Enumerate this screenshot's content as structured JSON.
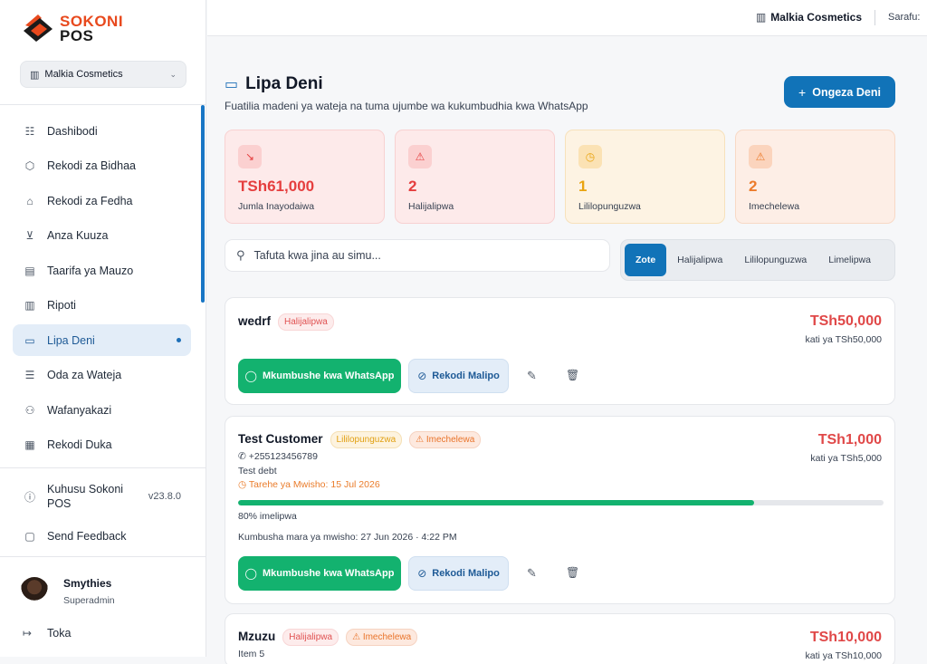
{
  "brand": {
    "line1": "SOKONI",
    "line2": "POS"
  },
  "store_selector": {
    "value": "Malkia Cosmetics"
  },
  "nav": [
    {
      "label": "Dashibodi",
      "icon": "grid-icon",
      "glyph": "☷"
    },
    {
      "label": "Rekodi za Bidhaa",
      "icon": "box-icon",
      "glyph": "⬡"
    },
    {
      "label": "Rekodi za Fedha",
      "icon": "bank-icon",
      "glyph": "⌂"
    },
    {
      "label": "Anza Kuuza",
      "icon": "cart-icon",
      "glyph": "⊻"
    },
    {
      "label": "Taarifa ya Mauzo",
      "icon": "clipboard-icon",
      "glyph": "▤"
    },
    {
      "label": "Ripoti",
      "icon": "bar-chart-icon",
      "glyph": "▥"
    },
    {
      "label": "Lipa Deni",
      "icon": "wallet-icon",
      "glyph": "▭",
      "active": true
    },
    {
      "label": "Oda za Wateja",
      "icon": "list-icon",
      "glyph": "☰"
    },
    {
      "label": "Wafanyakazi",
      "icon": "users-icon",
      "glyph": "⚇"
    },
    {
      "label": "Rekodi Duka",
      "icon": "store-icon",
      "glyph": "▦"
    }
  ],
  "about": {
    "label": "Kuhusu Sokoni POS",
    "version": "v23.8.0"
  },
  "feedback": {
    "label": "Send Feedback"
  },
  "user": {
    "name": "Smythies",
    "role": "Superadmin"
  },
  "logout": {
    "label": "Toka"
  },
  "topbar": {
    "store": "Malkia Cosmetics",
    "currency": "Sarafu:"
  },
  "page": {
    "title": "Lipa Deni",
    "subtitle": "Fuatilia madeni ya wateja na tuma ujumbe wa kukumbudhia kwa WhatsApp",
    "add_button": "Ongeza Deni"
  },
  "stats": [
    {
      "value": "TSh61,000",
      "label": "Jumla Inayodaiwa",
      "tone": "red",
      "icon": "trending-down-icon",
      "glyph": "↘"
    },
    {
      "value": "2",
      "label": "Halijalipwa",
      "tone": "red",
      "icon": "alert-icon",
      "glyph": "⚠"
    },
    {
      "value": "1",
      "label": "Lililopunguzwa",
      "tone": "yellow",
      "icon": "clock-icon",
      "glyph": "◷"
    },
    {
      "value": "2",
      "label": "Imechelewa",
      "tone": "orange",
      "icon": "alert-icon",
      "glyph": "⚠"
    }
  ],
  "search": {
    "placeholder": "Tafuta kwa jina au simu..."
  },
  "filters": [
    {
      "label": "Zote",
      "active": true
    },
    {
      "label": "Halijalipwa"
    },
    {
      "label": "Lililopunguzwa"
    },
    {
      "label": "Limelipwa"
    }
  ],
  "actions": {
    "whatsapp": "Mkumbushe kwa WhatsApp",
    "record_payment": "Rekodi Malipo"
  },
  "debts": [
    {
      "name": "wedrf",
      "badges": [
        {
          "label": "Halijalipwa",
          "tone": "red"
        }
      ],
      "amount": "TSh50,000",
      "of_total": "kati ya TSh50,000"
    },
    {
      "name": "Test Customer",
      "badges": [
        {
          "label": "Lililopunguzwa",
          "tone": "yellow"
        },
        {
          "label": "Imechelewa",
          "tone": "orange",
          "glyph": "⚠"
        }
      ],
      "amount": "TSh1,000",
      "of_total": "kati ya TSh5,000",
      "phone": "+255123456789",
      "note": "Test debt",
      "due": "Tarehe ya Mwisho: 15 Jul 2026",
      "progress": 0.8,
      "progress_label": "80% imelipwa",
      "last_reminder": "Kumbusha mara ya mwisho: 27 Jun 2026 · 4:22 PM"
    },
    {
      "name": "Mzuzu",
      "badges": [
        {
          "label": "Halijalipwa",
          "tone": "red"
        },
        {
          "label": "Imechelewa",
          "tone": "orange",
          "glyph": "⚠"
        }
      ],
      "amount": "TSh10,000",
      "of_total": "kati ya TSh10,000",
      "note": "Item 5"
    }
  ]
}
